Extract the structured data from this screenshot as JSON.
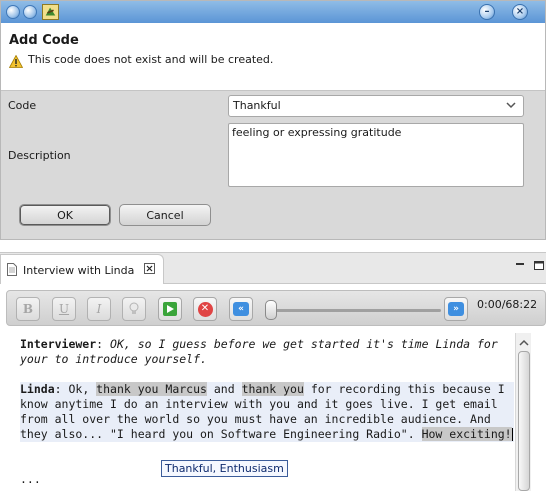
{
  "dialog": {
    "title": "Add Code",
    "message": "This code does not exist and will be created.",
    "code_label": "Code",
    "code_value": "Thankful",
    "description_label": "Description",
    "description_value": "feeling or expressing gratitude",
    "ok_label": "OK",
    "cancel_label": "Cancel"
  },
  "editor": {
    "tab_label": "Interview with Linda",
    "time": "0:00/68:22",
    "toolbar": {
      "bold": "B",
      "underline": "U",
      "italic": "I"
    },
    "transcript": {
      "p1_speaker": "Interviewer",
      "p1_colon": ":",
      "p1_text": " OK, so I guess before we get started it's time Linda for your to introduce yourself.",
      "p2_speaker": "Linda",
      "p2_t1": ": Ok, ",
      "p2_h1": "thank you Marcus",
      "p2_t2": " and ",
      "p2_h2": "thank you",
      "p2_t3": " for recording this because I know anytime I do an interview with you and it goes live. I get email from all over the world so you must have an incredible audience. And they also... \"I heard you on Software Engineering Radio\". ",
      "p2_h3": "How exciting!",
      "ellipsis": "..."
    },
    "tooltip": "Thankful, Enthusiasm"
  },
  "colors": {
    "titlebar": "#5b95d6",
    "dialog_bg": "#d9d9d9",
    "highlight": "#c8c8c8",
    "para_highlight": "#e9eef8"
  }
}
